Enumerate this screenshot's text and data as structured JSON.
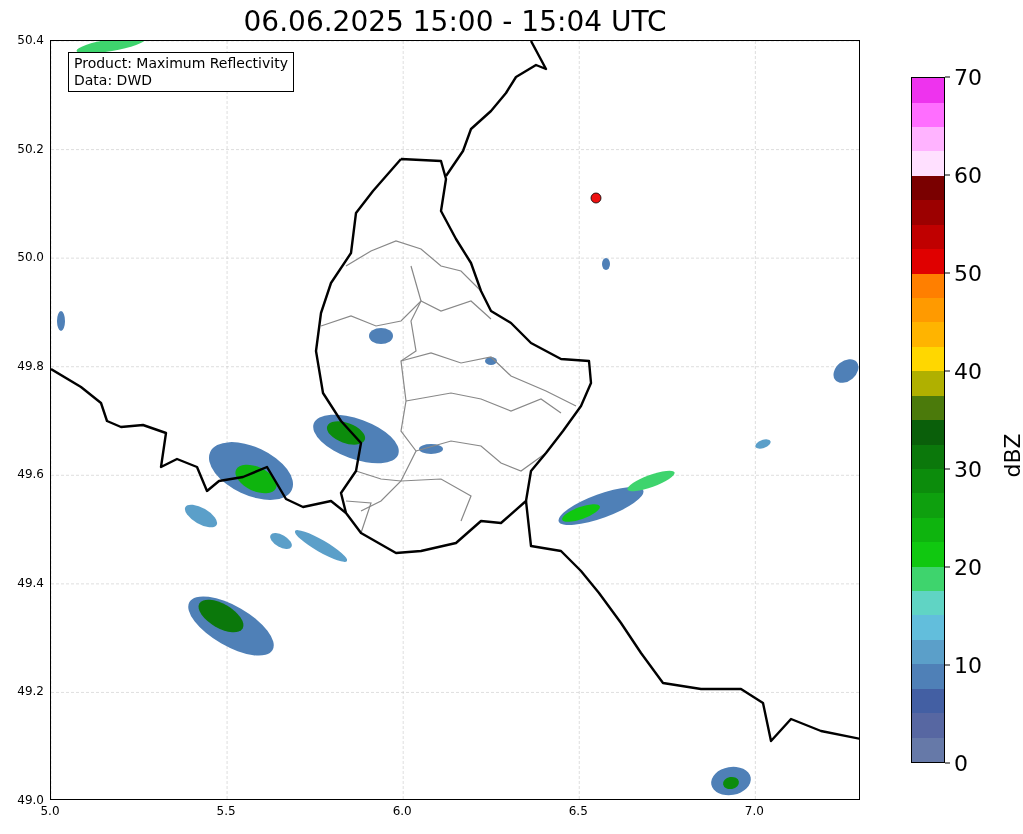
{
  "title": "06.06.2025 15:00 - 15:04 UTC",
  "annotation": {
    "lines": [
      "Product: Maximum Reflectivity",
      "Data: DWD"
    ]
  },
  "x_axis": {
    "ticks": [
      "5.0",
      "5.5",
      "6.0",
      "6.5",
      "7.0"
    ]
  },
  "y_axis": {
    "ticks": [
      "50.4",
      "50.2",
      "50.0",
      "49.8",
      "49.6",
      "49.4",
      "49.2",
      "49.0"
    ]
  },
  "colorbar": {
    "label": "dBZ",
    "ticks": [
      "70",
      "60",
      "50",
      "40",
      "30",
      "20",
      "10",
      "0"
    ],
    "segments": [
      {
        "color": "#6679a8"
      },
      {
        "color": "#5767a2"
      },
      {
        "color": "#435fa3"
      },
      {
        "color": "#4f80b7"
      },
      {
        "color": "#5b9fc9"
      },
      {
        "color": "#62bedc"
      },
      {
        "color": "#60d4c4"
      },
      {
        "color": "#3ed46d"
      },
      {
        "color": "#10c810"
      },
      {
        "color": "#0eb40e"
      },
      {
        "color": "#0ea00e"
      },
      {
        "color": "#0c8c0c"
      },
      {
        "color": "#0b780b"
      },
      {
        "color": "#0a5f0a"
      },
      {
        "color": "#4b7a0b"
      },
      {
        "color": "#b0b000"
      },
      {
        "color": "#ffd700"
      },
      {
        "color": "#ffb400"
      },
      {
        "color": "#ff9a00"
      },
      {
        "color": "#ff7f00"
      },
      {
        "color": "#e00000"
      },
      {
        "color": "#c00000"
      },
      {
        "color": "#9c0000"
      },
      {
        "color": "#7a0000"
      },
      {
        "color": "#ffe0ff"
      },
      {
        "color": "#ffb3ff"
      },
      {
        "color": "#ff6eff"
      },
      {
        "color": "#ee33ee"
      }
    ]
  }
}
